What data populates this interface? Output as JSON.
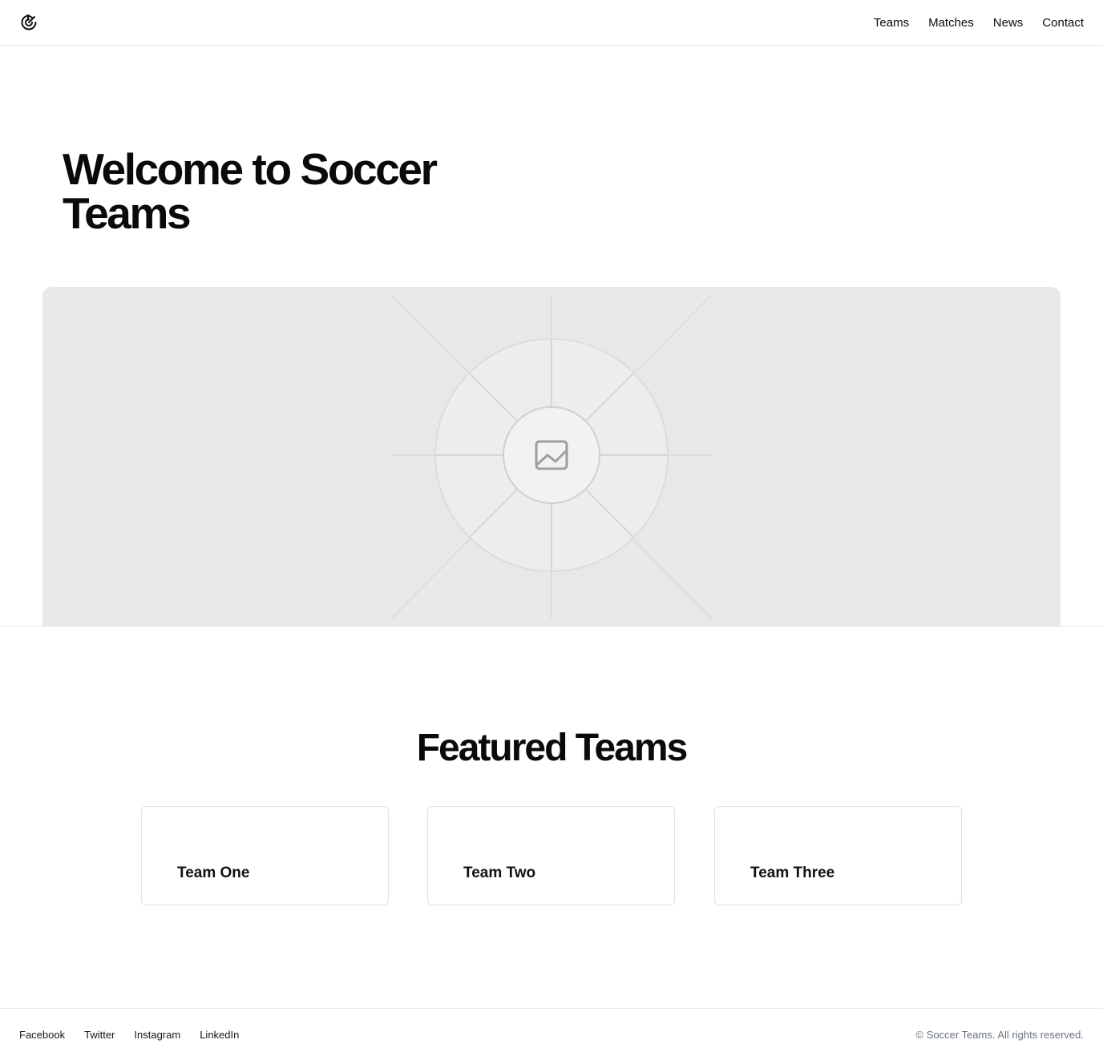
{
  "header": {
    "logo_icon": "target-arrow-logo-icon",
    "nav": [
      {
        "label": "Teams"
      },
      {
        "label": "Matches"
      },
      {
        "label": "News"
      },
      {
        "label": "Contact"
      }
    ]
  },
  "hero": {
    "title": "Welcome to Soccer Teams",
    "image_icon": "image-placeholder-icon"
  },
  "featured": {
    "title": "Featured Teams",
    "teams": [
      {
        "name": "Team One"
      },
      {
        "name": "Team Two"
      },
      {
        "name": "Team Three"
      }
    ]
  },
  "footer": {
    "links": [
      {
        "label": "Facebook"
      },
      {
        "label": "Twitter"
      },
      {
        "label": "Instagram"
      },
      {
        "label": "LinkedIn"
      }
    ],
    "copyright": "© Soccer Teams. All rights reserved."
  },
  "colors": {
    "text": "#0a0a0a",
    "muted": "#6b7280",
    "border": "#e5e5e5",
    "placeholder_bg": "#e8e8e8"
  }
}
